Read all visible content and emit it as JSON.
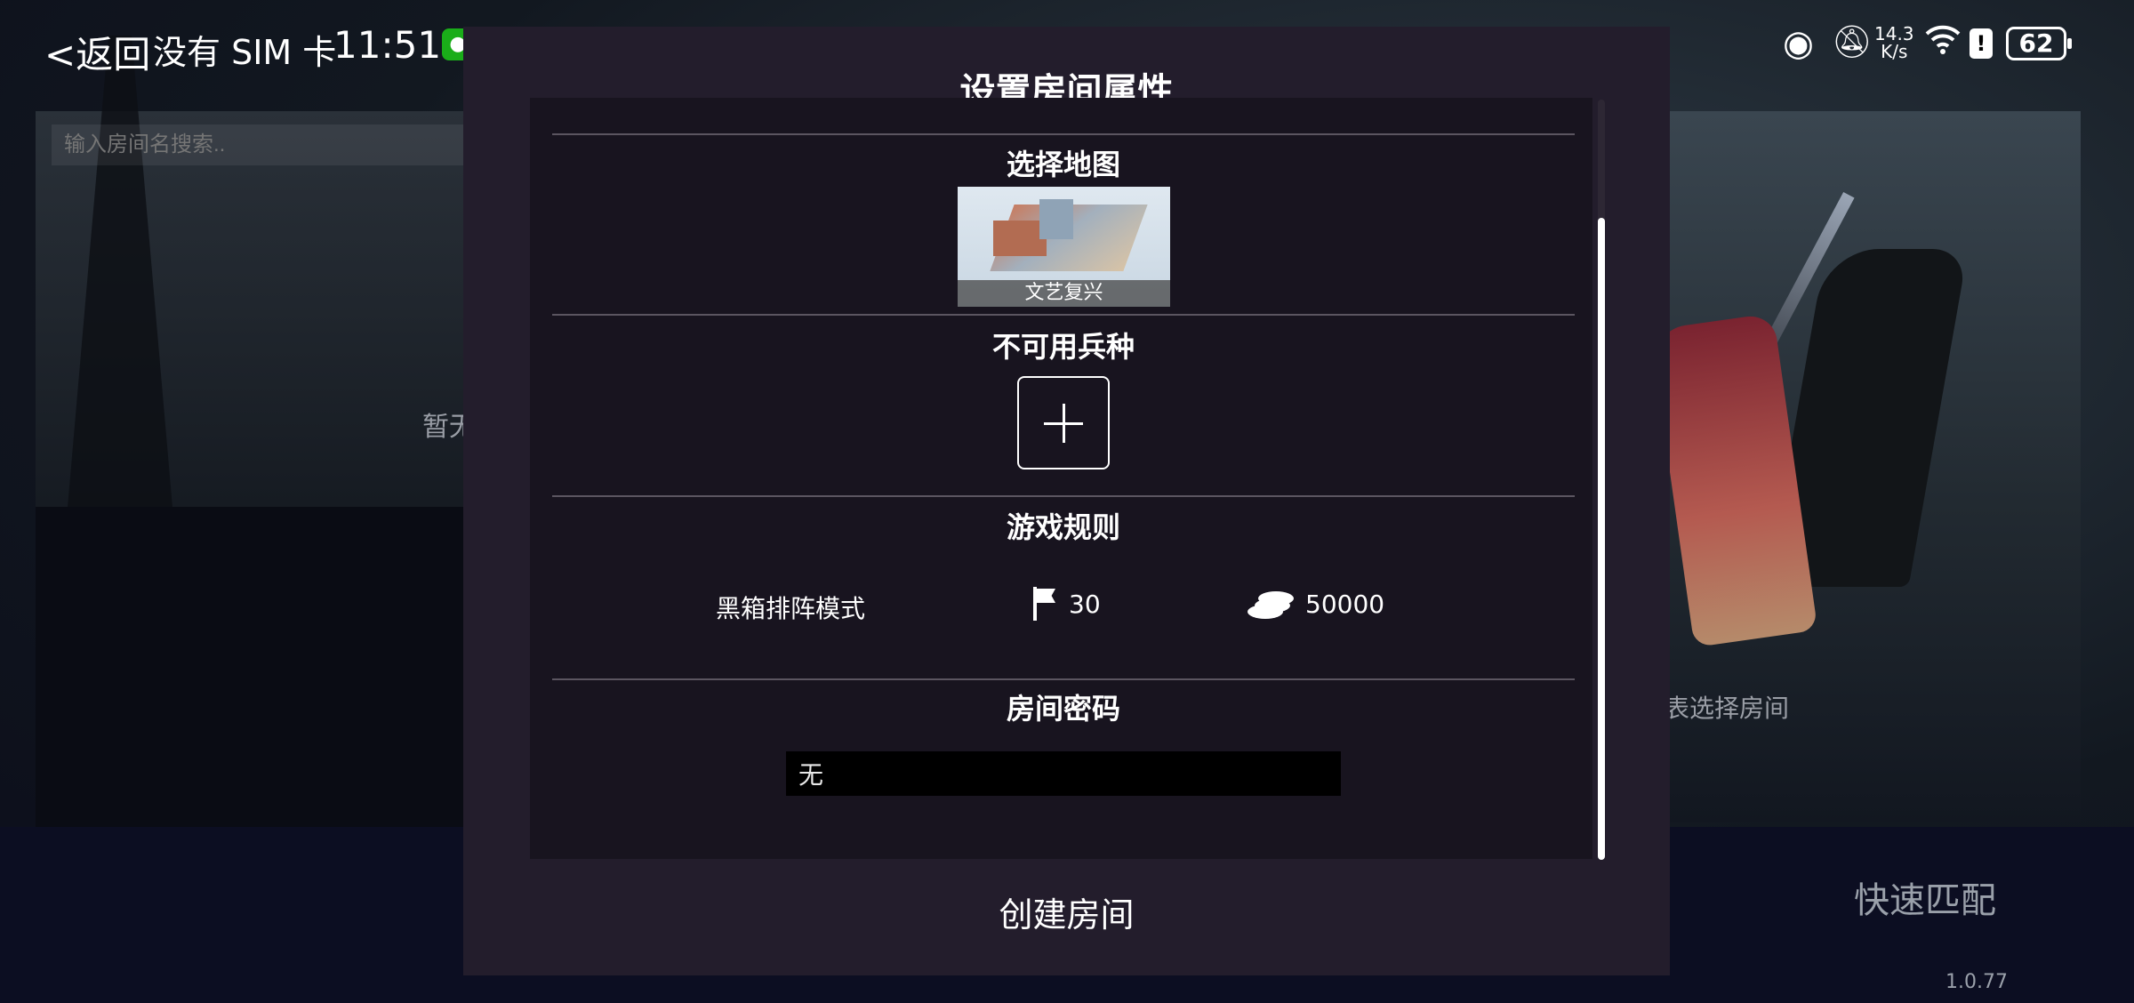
{
  "status_bar": {
    "back_label": "<返回",
    "carrier": "没有 SIM 卡",
    "time": "11:51",
    "network_speed_value": "14.3",
    "network_speed_unit": "K/s",
    "battery": "62",
    "app_icons": [
      "wechat-icon",
      "huawei-icon",
      "video-app-icon",
      "reader-icon"
    ],
    "status_icons": [
      "eye-icon",
      "bell-off-icon",
      "wifi-icon",
      "alert-icon",
      "battery-icon"
    ]
  },
  "background": {
    "search_placeholder": "输入房间名搜索..",
    "empty_text": "暂无",
    "hint_text": "表选择房间",
    "quick_match_label": "快速匹配",
    "version": "1.0.77"
  },
  "dialog": {
    "title": "设置房间属性",
    "map_section": {
      "title": "选择地图",
      "selected_map": "文艺复兴"
    },
    "disabled_units_section": {
      "title": "不可用兵种"
    },
    "rules_section": {
      "title": "游戏规则",
      "mode": "黑箱排阵模式",
      "unit_limit": "30",
      "gold": "50000"
    },
    "password_section": {
      "title": "房间密码",
      "value": "无"
    },
    "create_button_label": "创建房间"
  },
  "colors": {
    "dialog_bg": "#231d2c",
    "panel_bg": "#18141f",
    "text": "#ffffff",
    "divider": "#5b5560"
  }
}
